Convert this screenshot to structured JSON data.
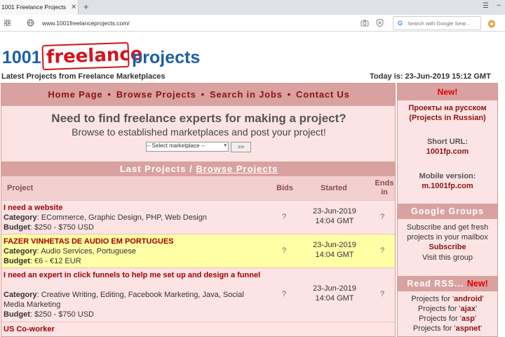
{
  "browser": {
    "tab_title": "1001 Freelance Projects",
    "url": "www.1001freelanceprojects.com/",
    "search_placeholder": "Search with Google Sear..."
  },
  "logo": {
    "part1": "1001",
    "part2": "freelance",
    "part3": "projects"
  },
  "header": {
    "tagline": "Latest Projects from Freelance Marketplaces",
    "today": "Today is: 23-Jun-2019 15:12 GMT"
  },
  "nav": {
    "items": [
      "Home Page",
      "Browse Projects",
      "Search in Jobs",
      "Contact Us"
    ],
    "separator": "•"
  },
  "promo": {
    "title": "Need to find freelance experts for making a project?",
    "subtitle": "Browse to established marketplaces and post your project!",
    "select_value": "-- Select marketplace --",
    "go_label": ">>"
  },
  "projects_header": {
    "label": "Last Projects /",
    "link": "Browse Projects"
  },
  "columns": {
    "project": "Project",
    "bids": "Bids",
    "started": "Started",
    "ends_line1": "Ends",
    "ends_line2": "in"
  },
  "projects": [
    {
      "title": "I need a website",
      "category_label": "Category",
      "category": ": ECommerce, Graphic Design, PHP, Web Design",
      "budget_label": "Budget",
      "budget": ": $250 - $750 USD",
      "bids": "?",
      "started_date": "23-Jun-2019",
      "started_time": "14:04 GMT",
      "ends": "?"
    },
    {
      "title": "FAZER VINHETAS DE AUDIO EM PORTUGUES",
      "category_label": "Category",
      "category": ": Audio Services, Portuguese",
      "budget_label": "Budget",
      "budget": ": €6 - €12 EUR",
      "bids": "?",
      "started_date": "23-Jun-2019",
      "started_time": "14:04 GMT",
      "ends": "?"
    },
    {
      "title": "I need an expert in click funnels to help me set up and design a funnel",
      "category_label": "Category",
      "category": ": Creative Writing, Editing, Facebook Marketing, Java, Social Media Marketing",
      "budget_label": "Budget",
      "budget": ": $250 - $750 USD",
      "bids": "?",
      "started_date": "23-Jun-2019",
      "started_time": "14:04 GMT",
      "ends": "?"
    },
    {
      "title": "US Co-worker",
      "category_label": "",
      "category": "",
      "budget_label": "",
      "budget": "",
      "bids": "",
      "started_date": "",
      "started_time": "",
      "ends": ""
    }
  ],
  "sidebar": {
    "new_label": "New!",
    "russian_line1": "Проекты на русском",
    "russian_line2": "(Projects in Russian)",
    "short_url_label": "Short URL:",
    "short_url": "1001fp.com",
    "mobile_label": "Mobile version:",
    "mobile_url": "m.1001fp.com",
    "google_groups": "Google Groups",
    "gg_text1": "Subscribe and get fresh",
    "gg_text2": "projects in your mailbox",
    "gg_subscribe": "Subscribe",
    "gg_visit": "Visit this group",
    "rss_label": "Read RSS...",
    "rss_new": "New!",
    "rss_items": [
      {
        "prefix": "Projects for '",
        "tag": "android",
        "suffix": "'"
      },
      {
        "prefix": "Projects for '",
        "tag": "ajax",
        "suffix": "'"
      },
      {
        "prefix": "Projects for '",
        "tag": "asp",
        "suffix": "'"
      },
      {
        "prefix": "Projects for '",
        "tag": "aspnet",
        "suffix": "'"
      }
    ]
  },
  "colors": {
    "nav_bg": "#daa1a1",
    "panel_bg": "#fde4e4",
    "link_dark_red": "#8b1313",
    "highlight_row": "#ffffa6",
    "logo_blue": "#1d5ea8",
    "logo_red": "#d4141d"
  }
}
